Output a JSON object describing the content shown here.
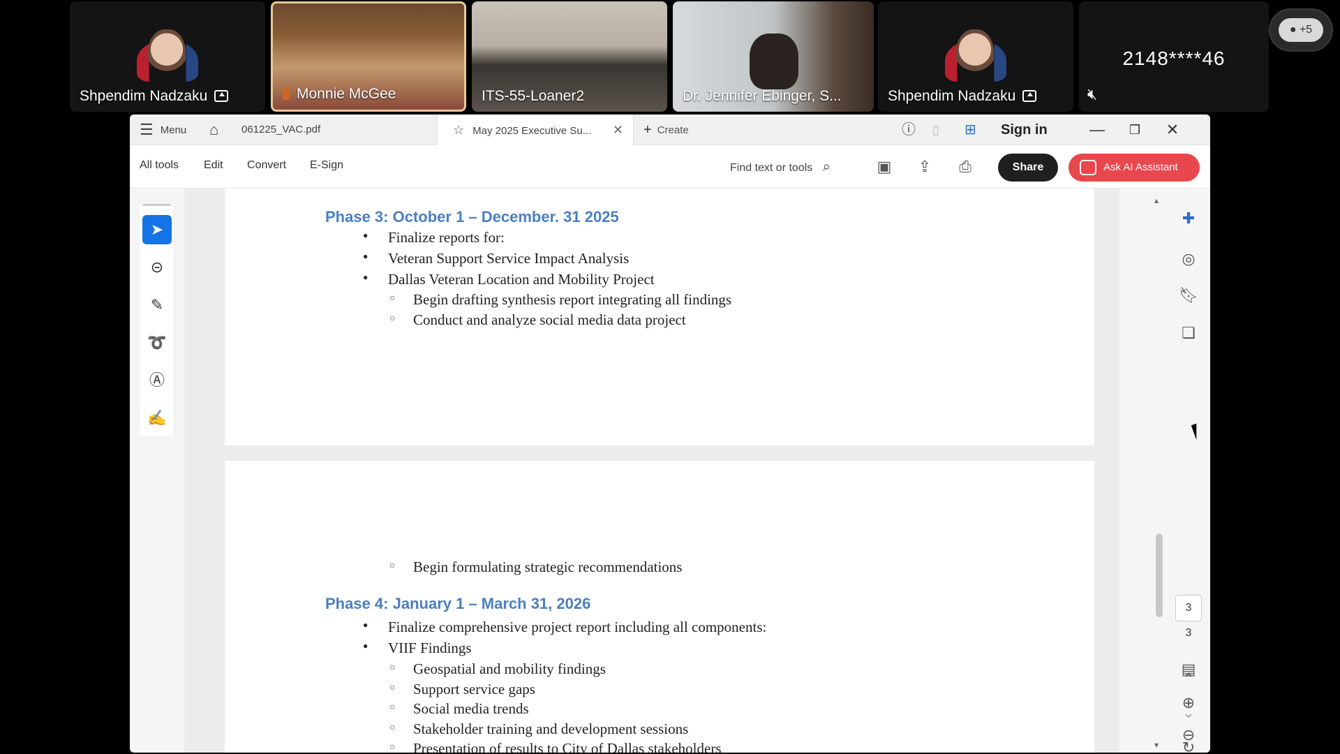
{
  "participants": [
    {
      "name": "Shpendim Nadzaku",
      "shared_screen_icon": "share-screen-icon"
    },
    {
      "name": "Monnie McGee",
      "mic": "mic-off-icon"
    },
    {
      "name": "ITS-55-Loaner2"
    },
    {
      "name": "Dr. Jennifer Ebinger, S..."
    },
    {
      "name": "Shpendim Nadzaku",
      "shared_screen_icon": "share-screen-icon"
    },
    {
      "name": "2148****46",
      "audio": "speaker-muted-icon"
    }
  ],
  "more_participants": "+5",
  "acrobat": {
    "menu_label": "Menu",
    "tabs": [
      {
        "label": "061225_VAC.pdf"
      },
      {
        "label": "May 2025 Executive Su..."
      }
    ],
    "create_label": "Create",
    "sign_in": "Sign in",
    "toolbar": {
      "all_tools": "All tools",
      "edit": "Edit",
      "convert": "Convert",
      "esign": "E-Sign",
      "find_placeholder": "Find text or tools",
      "share": "Share",
      "ai_assistant": "Ask AI Assistant"
    },
    "page_current": "3",
    "page_total": "3"
  },
  "document": {
    "phase3": {
      "heading": "Phase 3: October 1 – December. 31 2025",
      "bullets": [
        "Finalize reports for:",
        "Veteran Support Service Impact Analysis",
        "Dallas Veteran Location and Mobility Project"
      ],
      "subbullets": [
        "Begin drafting synthesis report integrating all findings",
        "Conduct and analyze social media data project"
      ]
    },
    "page2_sub": "Begin formulating strategic recommendations",
    "phase4": {
      "heading": "Phase 4: January 1 – March 31, 2026",
      "bullets": [
        "Finalize comprehensive project report including all components:",
        "VIIF Findings"
      ],
      "subbullets": [
        "Geospatial and mobility findings",
        "Support service gaps",
        "Social media trends",
        "Stakeholder training and development sessions",
        "Presentation of results to City of Dallas stakeholders"
      ]
    }
  }
}
